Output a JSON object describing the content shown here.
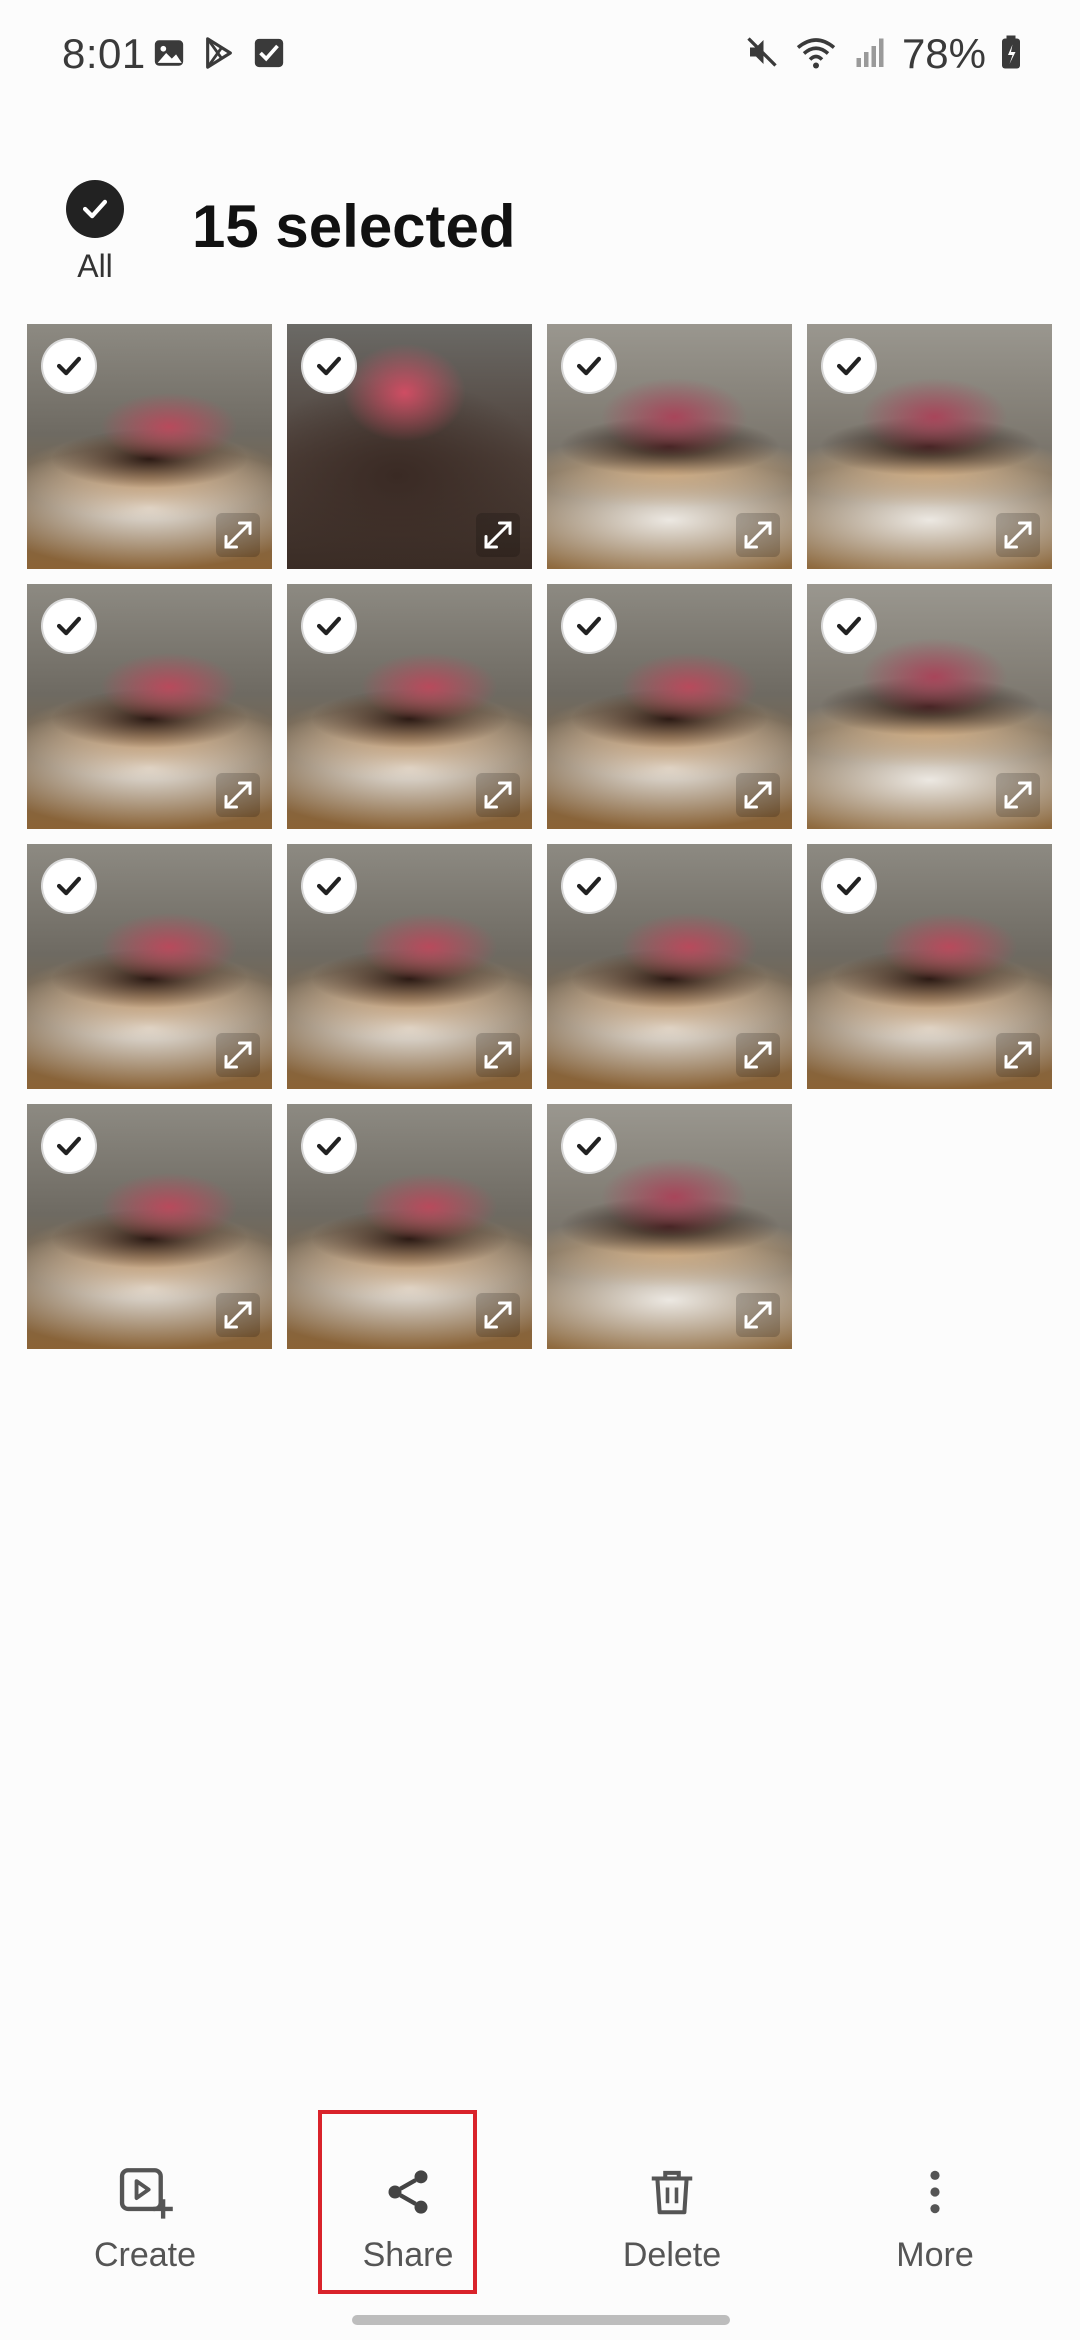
{
  "status_bar": {
    "time": "8:01",
    "battery": "78%",
    "left_icons": [
      "gallery-icon",
      "play-store-icon",
      "checkbox-icon"
    ],
    "right_icons": [
      "mute-icon",
      "wifi-icon",
      "signal-icon",
      "battery-icon"
    ]
  },
  "header": {
    "select_all_label": "All",
    "title": "15 selected"
  },
  "grid": {
    "items": [
      {
        "selected": true
      },
      {
        "selected": true
      },
      {
        "selected": true
      },
      {
        "selected": true
      },
      {
        "selected": true
      },
      {
        "selected": true
      },
      {
        "selected": true
      },
      {
        "selected": true
      },
      {
        "selected": true
      },
      {
        "selected": true
      },
      {
        "selected": true
      },
      {
        "selected": true
      },
      {
        "selected": true
      },
      {
        "selected": true
      },
      {
        "selected": true
      }
    ]
  },
  "toolbar": {
    "create_label": "Create",
    "share_label": "Share",
    "delete_label": "Delete",
    "more_label": "More"
  },
  "colors": {
    "background": "#fcfcfc",
    "highlight": "#d9232b",
    "check_fill": "#222222"
  }
}
